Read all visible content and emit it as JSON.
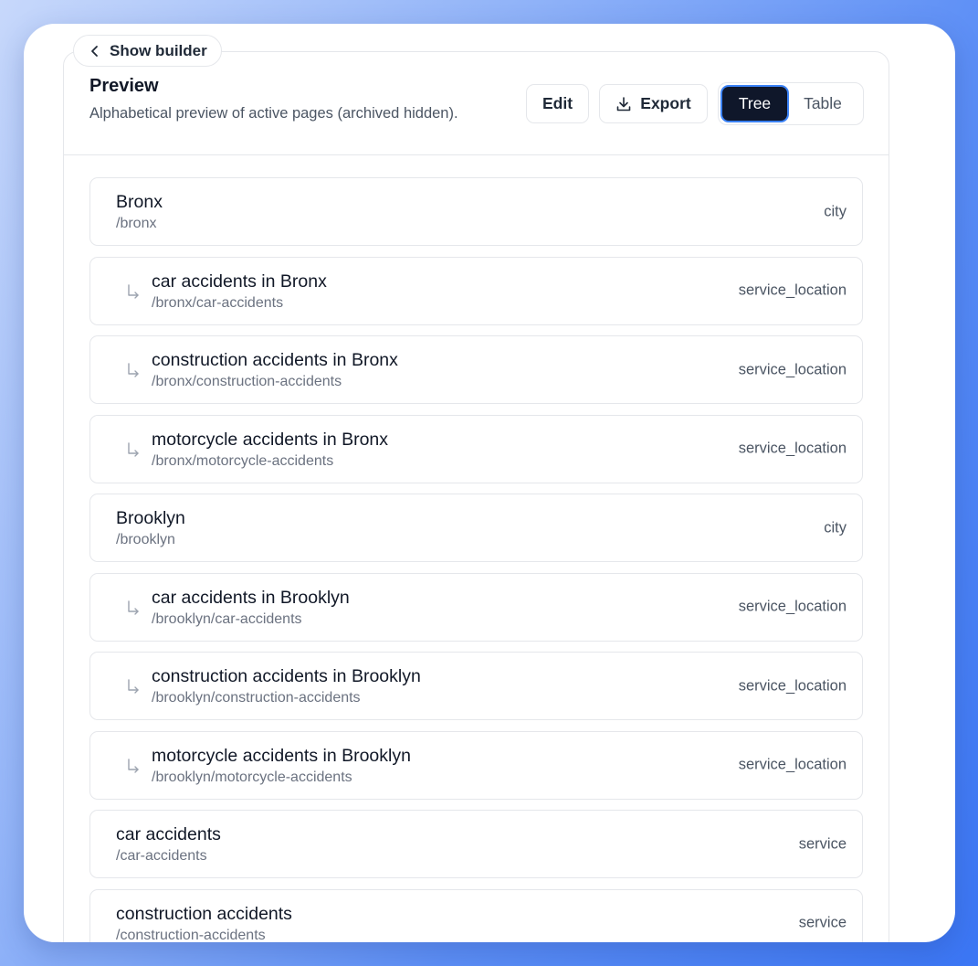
{
  "back_button": {
    "label": "Show builder"
  },
  "header": {
    "title": "Preview",
    "subtitle": "Alphabetical preview of active pages (archived hidden)."
  },
  "toolbar": {
    "edit_label": "Edit",
    "export_label": "Export",
    "view_toggle": {
      "selected": "Tree",
      "options": [
        "Tree",
        "Table"
      ]
    }
  },
  "rows": [
    {
      "name": "Bronx",
      "path": "/bronx",
      "type": "city",
      "level": 0
    },
    {
      "name": "car accidents in Bronx",
      "path": "/bronx/car-accidents",
      "type": "service_location",
      "level": 1
    },
    {
      "name": "construction accidents in Bronx",
      "path": "/bronx/construction-accidents",
      "type": "service_location",
      "level": 1
    },
    {
      "name": "motorcycle accidents in Bronx",
      "path": "/bronx/motorcycle-accidents",
      "type": "service_location",
      "level": 1
    },
    {
      "name": "Brooklyn",
      "path": "/brooklyn",
      "type": "city",
      "level": 0
    },
    {
      "name": "car accidents in Brooklyn",
      "path": "/brooklyn/car-accidents",
      "type": "service_location",
      "level": 1
    },
    {
      "name": "construction accidents in Brooklyn",
      "path": "/brooklyn/construction-accidents",
      "type": "service_location",
      "level": 1
    },
    {
      "name": "motorcycle accidents in Brooklyn",
      "path": "/brooklyn/motorcycle-accidents",
      "type": "service_location",
      "level": 1
    },
    {
      "name": "car accidents",
      "path": "/car-accidents",
      "type": "service",
      "level": 0
    },
    {
      "name": "construction accidents",
      "path": "/construction-accidents",
      "type": "service",
      "level": 0
    }
  ]
}
